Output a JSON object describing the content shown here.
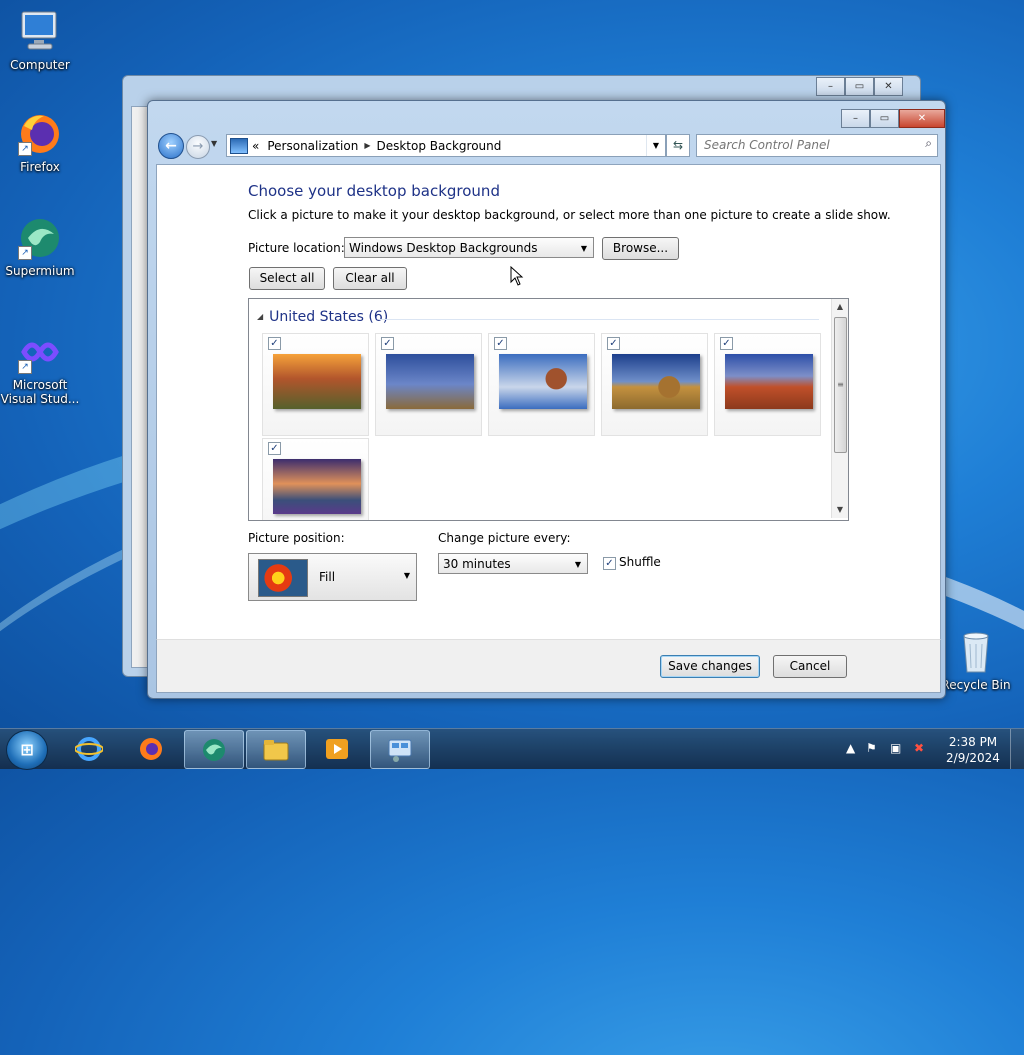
{
  "desktop": {
    "icons": [
      {
        "label": "Computer"
      },
      {
        "label": "Firefox"
      },
      {
        "label": "Supermium"
      },
      {
        "label": "Microsoft Visual Stud..."
      },
      {
        "label": "Recycle Bin"
      }
    ]
  },
  "window": {
    "controls": {
      "minimize": "–",
      "maximize": "▭",
      "close": "✕"
    },
    "breadcrumb": {
      "prefix": "«",
      "items": [
        "Personalization",
        "Desktop Background"
      ]
    },
    "search_placeholder": "Search Control Panel",
    "heading": "Choose your desktop background",
    "subheading": "Click a picture to make it your desktop background, or select more than one picture to create a slide show.",
    "picture_location": {
      "label": "Picture location:",
      "value": "Windows Desktop Backgrounds",
      "browse_label": "Browse..."
    },
    "select_all_label": "Select all",
    "clear_all_label": "Clear all",
    "gallery": {
      "group_title": "United States (6)",
      "tiles": [
        {
          "checked": "✓",
          "colors": [
            "#f6a23a",
            "#b1552c",
            "#55612c"
          ]
        },
        {
          "checked": "✓",
          "colors": [
            "#2e4f9c",
            "#6b86c8",
            "#8a6a3a"
          ]
        },
        {
          "checked": "✓",
          "colors": [
            "#3b6dbf",
            "#c9d6ea",
            "#a0522d"
          ]
        },
        {
          "checked": "✓",
          "colors": [
            "#1d3f8c",
            "#6f8fc9",
            "#c4913f"
          ]
        },
        {
          "checked": "✓",
          "colors": [
            "#2d4fa8",
            "#c0502a",
            "#8c3a1c"
          ]
        },
        {
          "checked": "✓",
          "colors": [
            "#3c2d6e",
            "#e0915a",
            "#3b4f7a"
          ]
        }
      ]
    },
    "picture_position": {
      "label": "Picture position:",
      "value": "Fill"
    },
    "change_picture": {
      "label": "Change picture every:",
      "value": "30 minutes"
    },
    "shuffle": {
      "label": "Shuffle",
      "checked": "✓"
    },
    "save_label": "Save changes",
    "cancel_label": "Cancel"
  },
  "taskbar": {
    "time": "2:38 PM",
    "date": "2/9/2024",
    "tray_chevron": "▲"
  }
}
